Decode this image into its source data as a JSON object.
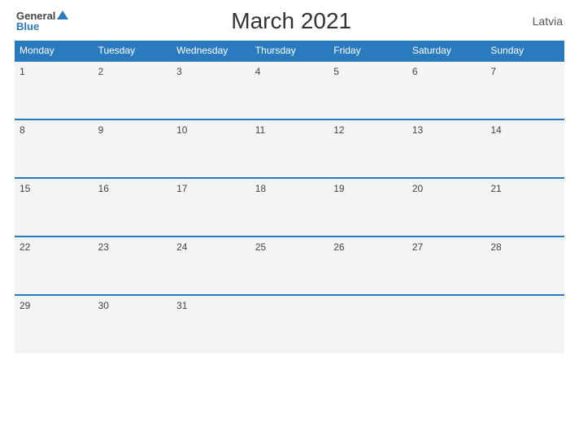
{
  "header": {
    "logo_general": "General",
    "logo_blue": "Blue",
    "title": "March 2021",
    "country": "Latvia"
  },
  "weekdays": [
    "Monday",
    "Tuesday",
    "Wednesday",
    "Thursday",
    "Friday",
    "Saturday",
    "Sunday"
  ],
  "weeks": [
    [
      1,
      2,
      3,
      4,
      5,
      6,
      7
    ],
    [
      8,
      9,
      10,
      11,
      12,
      13,
      14
    ],
    [
      15,
      16,
      17,
      18,
      19,
      20,
      21
    ],
    [
      22,
      23,
      24,
      25,
      26,
      27,
      28
    ],
    [
      29,
      30,
      31,
      null,
      null,
      null,
      null
    ]
  ]
}
